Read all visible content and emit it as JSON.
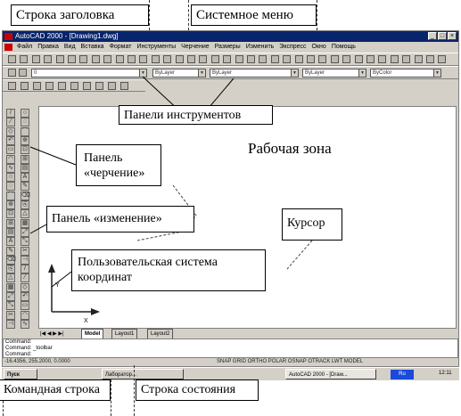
{
  "callouts": {
    "title_bar": "Строка заголовка",
    "system_menu": "Системное меню",
    "toolbars": "Панели инструментов",
    "work_zone": "Рабочая зона",
    "draw_panel": "Панель «черчение»",
    "modify_panel": "Панель «изменение»",
    "cursor": "Курсор",
    "ucs": "Пользовательская система координат",
    "command_line": "Командная строка",
    "status_line": "Строка состояния"
  },
  "window": {
    "title": "AutoCAD 2000 - [Drawing1.dwg]",
    "menu": [
      "Файл",
      "Правка",
      "Вид",
      "Вставка",
      "Формат",
      "Инструменты",
      "Черчение",
      "Размеры",
      "Изменить",
      "Экспресс",
      "Окно",
      "Помощь"
    ]
  },
  "props": {
    "layer": "0",
    "color": "ByLayer",
    "linetype": "ByLayer",
    "lineweight": "ByLayer",
    "plotstyle": "ByColor"
  },
  "tabs": [
    "Model",
    "Layout1",
    "Layout2"
  ],
  "command": {
    "line1": "Command:",
    "line2": "Command: _toolbar",
    "line3": "Command:"
  },
  "status": {
    "coords": "-16.4356, 255.2000, 0.0000",
    "modes": "SNAP GRID ORTHO POLAR OSNAP OTRACK LWT MODEL"
  },
  "taskbar": {
    "start": "Пуск",
    "task1": "Лаборатор...",
    "task2": "AutoCAD 2000 - [Draw...",
    "lang": "Ru",
    "clock": "12:11"
  }
}
